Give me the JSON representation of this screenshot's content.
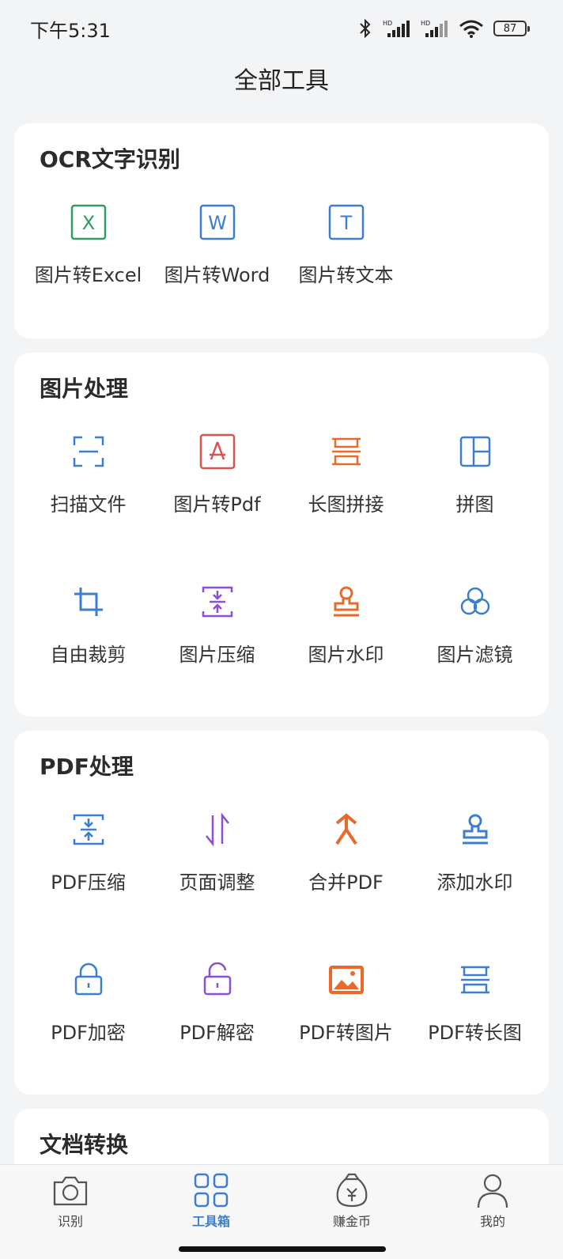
{
  "status": {
    "time": "下午5:31",
    "battery": "87"
  },
  "header": {
    "title": "全部工具"
  },
  "sections": {
    "ocr": {
      "title": "OCR文字识别",
      "items": [
        "图片转Excel",
        "图片转Word",
        "图片转文本"
      ]
    },
    "image": {
      "title": "图片处理",
      "items": [
        "扫描文件",
        "图片转Pdf",
        "长图拼接",
        "拼图",
        "自由裁剪",
        "图片压缩",
        "图片水印",
        "图片滤镜"
      ]
    },
    "pdf": {
      "title": "PDF处理",
      "items": [
        "PDF压缩",
        "页面调整",
        "合并PDF",
        "添加水印",
        "PDF加密",
        "PDF解密",
        "PDF转图片",
        "PDF转长图"
      ]
    },
    "doc": {
      "title": "文档转换"
    }
  },
  "tabbar": {
    "items": [
      "识别",
      "工具箱",
      "赚金币",
      "我的"
    ],
    "active_index": 1
  },
  "colors": {
    "blue": "#3b7ed0",
    "green": "#2e9d62",
    "orange": "#e8692a",
    "red": "#d9534f",
    "purple": "#8a4fd6",
    "active_tab": "#3b7ed0"
  }
}
